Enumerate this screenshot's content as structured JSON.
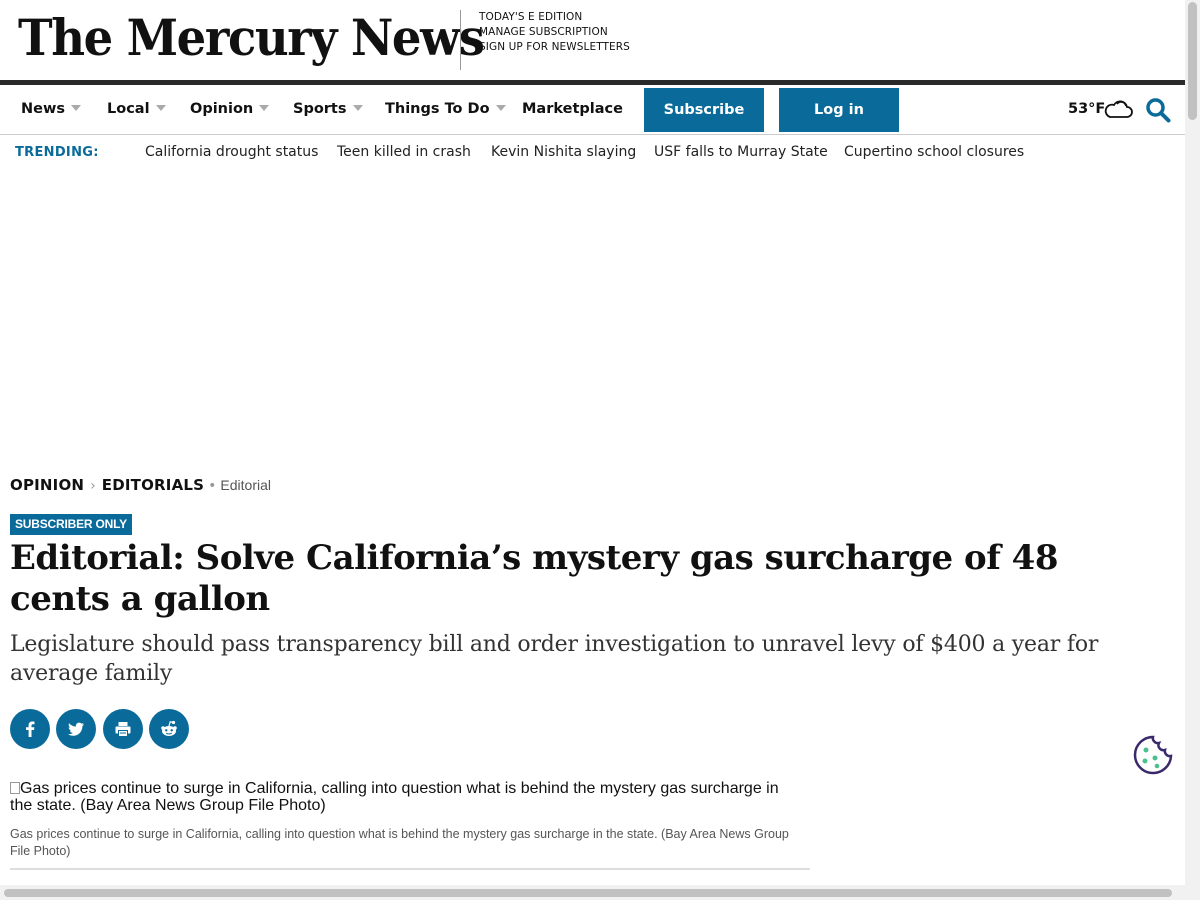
{
  "masthead": {
    "logo_text": "The Mercury News",
    "top_links": [
      "TODAY'S E EDITION",
      "MANAGE SUBSCRIPTION",
      "SIGN UP FOR NEWSLETTERS"
    ]
  },
  "nav": {
    "items": [
      {
        "label": "News",
        "has_dropdown": true
      },
      {
        "label": "Local",
        "has_dropdown": true
      },
      {
        "label": "Opinion",
        "has_dropdown": true
      },
      {
        "label": "Sports",
        "has_dropdown": true
      },
      {
        "label": "Things To Do",
        "has_dropdown": true
      },
      {
        "label": "Marketplace",
        "has_dropdown": false
      }
    ],
    "subscribe_label": "Subscribe",
    "login_label": "Log in",
    "weather_temp": "53°F",
    "weather_icon": "cloud-icon",
    "search_icon": "search-icon"
  },
  "trending": {
    "label": "TRENDING:",
    "links": [
      "California drought status",
      "Teen killed in crash",
      "Kevin Nishita slaying",
      "USF falls to Murray State",
      "Cupertino school closures"
    ]
  },
  "article": {
    "breadcrumb": [
      "OPINION",
      "EDITORIALS"
    ],
    "type": "Editorial",
    "badge": "SUBSCRIBER ONLY",
    "headline": "Editorial: Solve California’s mystery gas surcharge of 48 cents a gallon",
    "dek": "Legislature should pass transparency bill and order investigation to unravel levy of $400 a year for average family",
    "share_icons": [
      "facebook-icon",
      "twitter-icon",
      "print-icon",
      "reddit-icon"
    ],
    "image_alt": "Gas prices continue to surge in California, calling into question what is behind the mystery gas surcharge in the state. (Bay Area News Group File Photo)",
    "caption": "Gas prices continue to surge in California, calling into question what is behind the mystery gas surcharge in the state. (Bay Area News Group File Photo)"
  },
  "colors": {
    "brand_blue": "#0a6b9a",
    "cookie_purple": "#3b2a6b",
    "cookie_dots": "#4cbf8f"
  }
}
